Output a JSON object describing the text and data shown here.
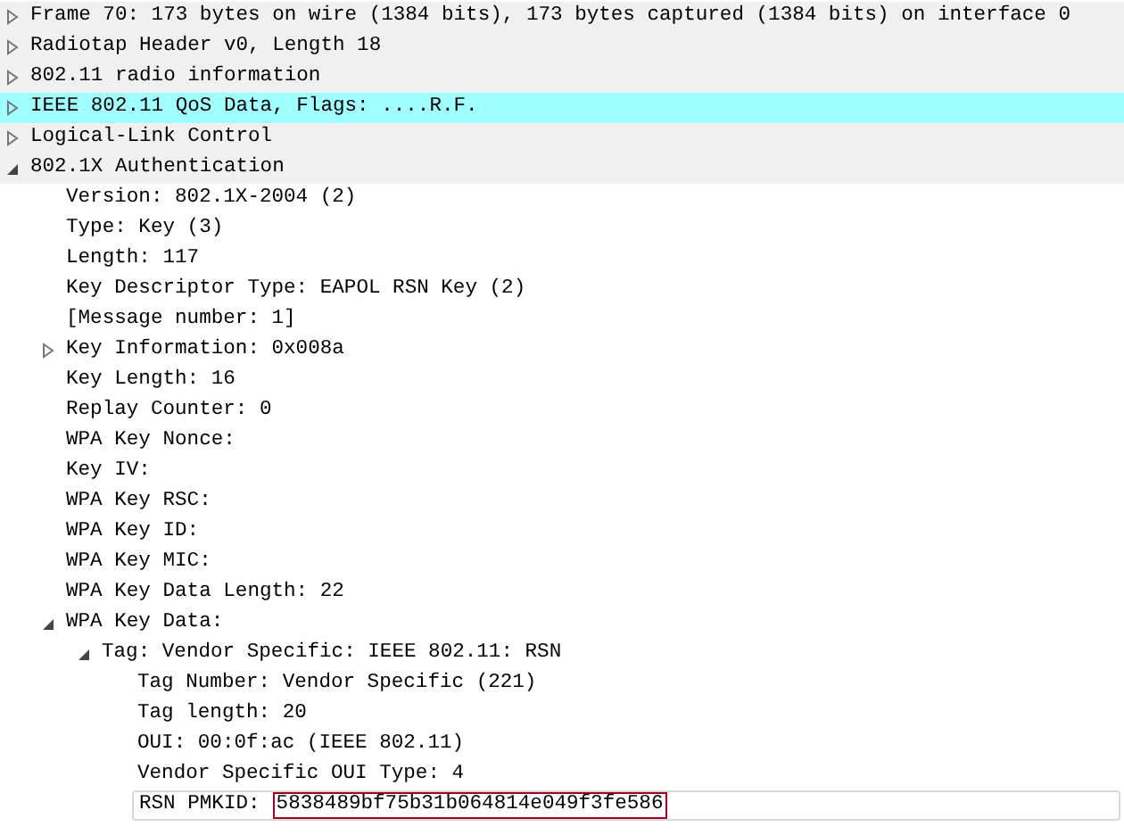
{
  "tree": [
    {
      "label": "Frame 70: 173 bytes on wire (1384 bits), 173 bytes captured (1384 bits) on interface 0",
      "expanded": false,
      "color": "#f0f0f0"
    },
    {
      "label": "Radiotap Header v0, Length 18",
      "expanded": false,
      "color": "#f0f0f0"
    },
    {
      "label": "802.11 radio information",
      "expanded": false,
      "color": "#f0f0f0"
    },
    {
      "label": "IEEE 802.11 QoS Data, Flags: ....R.F.",
      "expanded": false,
      "color": "#a0ffff"
    },
    {
      "label": "Logical-Link Control",
      "expanded": false,
      "color": "#f0f0f0"
    },
    {
      "label": "802.1X Authentication",
      "expanded": true,
      "color": "#f0f0f0",
      "children": [
        {
          "label": "Version: 802.1X-2004 (2)"
        },
        {
          "label": "Type: Key (3)"
        },
        {
          "label": "Length: 117"
        },
        {
          "label": "Key Descriptor Type: EAPOL RSN Key (2)"
        },
        {
          "label": "[Message number: 1]"
        },
        {
          "label": "Key Information: 0x008a",
          "expanded": false
        },
        {
          "label": "Key Length: 16"
        },
        {
          "label": "Replay Counter: 0"
        },
        {
          "label": "WPA Key Nonce:"
        },
        {
          "label": "Key IV:"
        },
        {
          "label": "WPA Key RSC:"
        },
        {
          "label": "WPA Key ID:"
        },
        {
          "label": "WPA Key MIC:"
        },
        {
          "label": "WPA Key Data Length: 22"
        },
        {
          "label": "WPA Key Data:",
          "expanded": true,
          "children": [
            {
              "label": "Tag: Vendor Specific: IEEE 802.11: RSN",
              "expanded": true,
              "children": [
                {
                  "label": "Tag Number: Vendor Specific (221)"
                },
                {
                  "label": "Tag length: 20"
                },
                {
                  "label": "OUI: 00:0f:ac (IEEE 802.11)"
                },
                {
                  "label": "Vendor Specific OUI Type: 4"
                },
                {
                  "label": "RSN PMKID:",
                  "value": "5838489bf75b31b064814e049f3fe586",
                  "selected": true
                }
              ]
            }
          ]
        }
      ]
    }
  ]
}
